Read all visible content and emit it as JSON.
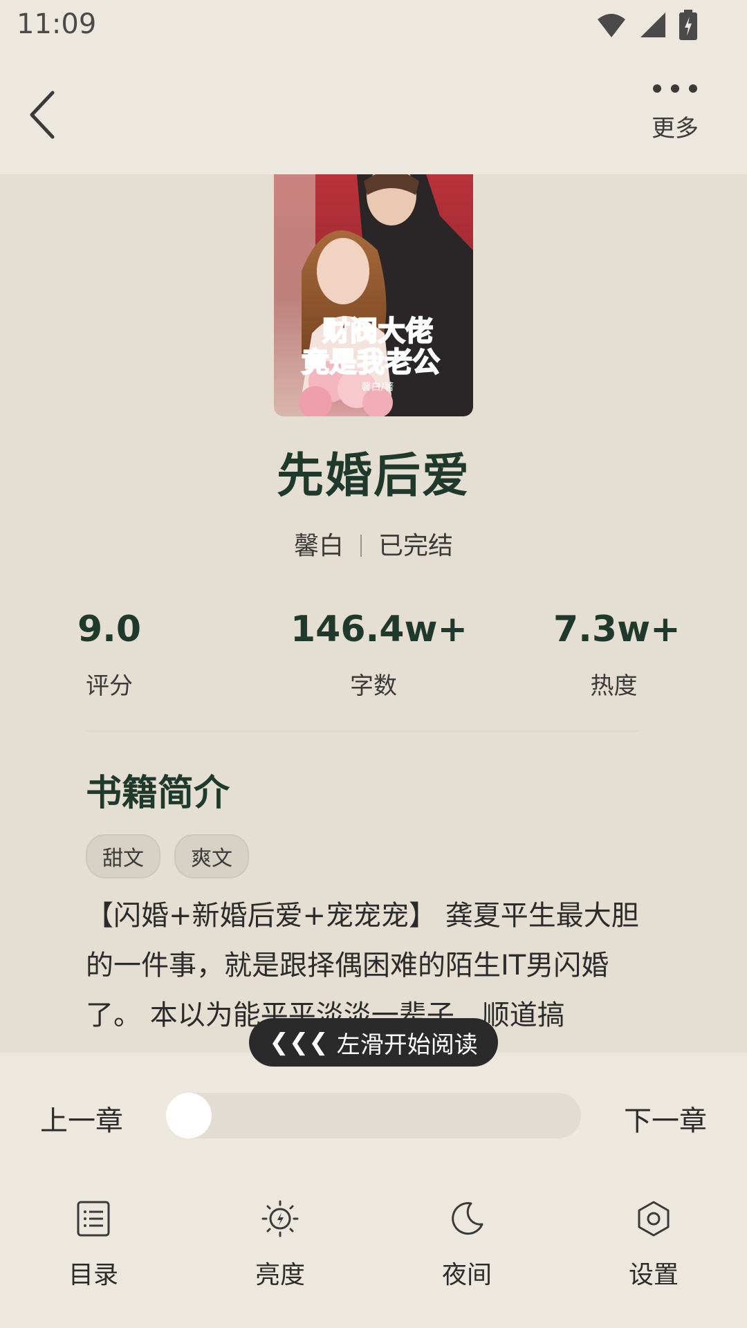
{
  "status": {
    "time": "11:09"
  },
  "topbar": {
    "more_label": "更多"
  },
  "book": {
    "title": "先婚后爱",
    "author": "馨白",
    "status": "已完结",
    "cover_title_line1": "财阀大佬",
    "cover_title_line2": "竟是我老公",
    "cover_author": "馨白/著"
  },
  "stats": [
    {
      "value": "9.0",
      "label": "评分"
    },
    {
      "value": "146.4w+",
      "label": "字数"
    },
    {
      "value": "7.3w+",
      "label": "热度"
    }
  ],
  "intro": {
    "title": "书籍简介",
    "tags": [
      "甜文",
      "爽文"
    ],
    "text": "【闪婚+新婚后爱+宠宠宠】 龚夏平生最大胆的一件事，就是跟择偶困难的陌生IT男闪婚了。 本以为能平平淡淡一辈子，顺道搞"
  },
  "swipe_hint": {
    "arrows": "❮❮❮",
    "label": "左滑开始阅读"
  },
  "reader_controls": {
    "prev_chapter": "上一章",
    "next_chapter": "下一章",
    "progress": 0.0
  },
  "menu": [
    {
      "label": "目录",
      "icon": "list-icon"
    },
    {
      "label": "亮度",
      "icon": "brightness-icon"
    },
    {
      "label": "夜间",
      "icon": "moon-icon"
    },
    {
      "label": "设置",
      "icon": "settings-icon"
    }
  ],
  "colors": {
    "title_green": "#1f3a2c",
    "panel_bg": "#ede8df",
    "page_bg": "#e5ded3"
  }
}
